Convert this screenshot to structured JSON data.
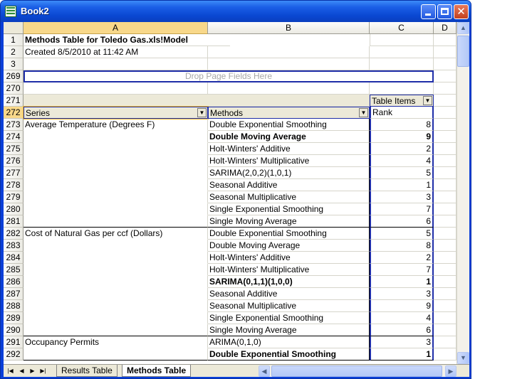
{
  "window": {
    "title": "Book2"
  },
  "columns": [
    "A",
    "B",
    "C",
    "D"
  ],
  "rows": {
    "r1": {
      "num": "1",
      "a": "Methods Table for Toledo Gas.xls!Model"
    },
    "r2": {
      "num": "2",
      "a": "Created 8/5/2010 at 11:42 AM"
    },
    "r3": {
      "num": "3"
    },
    "r269": {
      "num": "269",
      "page_fields": "Drop Page Fields Here"
    },
    "r270": {
      "num": "270"
    },
    "r271": {
      "num": "271",
      "table_items": "Table Items"
    },
    "r272": {
      "num": "272",
      "series": "Series",
      "methods": "Methods",
      "rank": "Rank"
    }
  },
  "data_rows": [
    {
      "num": "273",
      "series": "Average Temperature (Degrees F)",
      "method": "Double Exponential Smoothing",
      "rank": "8",
      "bold": false
    },
    {
      "num": "274",
      "series": "",
      "method": "Double Moving Average",
      "rank": "9",
      "bold": true
    },
    {
      "num": "275",
      "series": "",
      "method": "Holt-Winters' Additive",
      "rank": "2",
      "bold": false
    },
    {
      "num": "276",
      "series": "",
      "method": "Holt-Winters' Multiplicative",
      "rank": "4",
      "bold": false
    },
    {
      "num": "277",
      "series": "",
      "method": "SARIMA(2,0,2)(1,0,1)",
      "rank": "5",
      "bold": false
    },
    {
      "num": "278",
      "series": "",
      "method": "Seasonal Additive",
      "rank": "1",
      "bold": false
    },
    {
      "num": "279",
      "series": "",
      "method": "Seasonal Multiplicative",
      "rank": "3",
      "bold": false
    },
    {
      "num": "280",
      "series": "",
      "method": "Single Exponential Smoothing",
      "rank": "7",
      "bold": false
    },
    {
      "num": "281",
      "series": "",
      "method": "Single Moving Average",
      "rank": "6",
      "bold": false
    },
    {
      "num": "282",
      "series": "Cost of Natural Gas per ccf (Dollars)",
      "method": "Double Exponential Smoothing",
      "rank": "5",
      "bold": false
    },
    {
      "num": "283",
      "series": "",
      "method": "Double Moving Average",
      "rank": "8",
      "bold": false
    },
    {
      "num": "284",
      "series": "",
      "method": "Holt-Winters' Additive",
      "rank": "2",
      "bold": false
    },
    {
      "num": "285",
      "series": "",
      "method": "Holt-Winters' Multiplicative",
      "rank": "7",
      "bold": false
    },
    {
      "num": "286",
      "series": "",
      "method": "SARIMA(0,1,1)(1,0,0)",
      "rank": "1",
      "bold": true
    },
    {
      "num": "287",
      "series": "",
      "method": "Seasonal Additive",
      "rank": "3",
      "bold": false
    },
    {
      "num": "288",
      "series": "",
      "method": "Seasonal Multiplicative",
      "rank": "9",
      "bold": false
    },
    {
      "num": "289",
      "series": "",
      "method": "Single Exponential Smoothing",
      "rank": "4",
      "bold": false
    },
    {
      "num": "290",
      "series": "",
      "method": "Single Moving Average",
      "rank": "6",
      "bold": false
    },
    {
      "num": "291",
      "series": "Occupancy Permits",
      "method": "ARIMA(0,1,0)",
      "rank": "3",
      "bold": false
    },
    {
      "num": "292",
      "series": "",
      "method": "Double Exponential Smoothing",
      "rank": "1",
      "bold": true
    }
  ],
  "sheet_tabs": [
    "Results Table",
    "Methods Table"
  ],
  "active_tab": "Methods Table"
}
